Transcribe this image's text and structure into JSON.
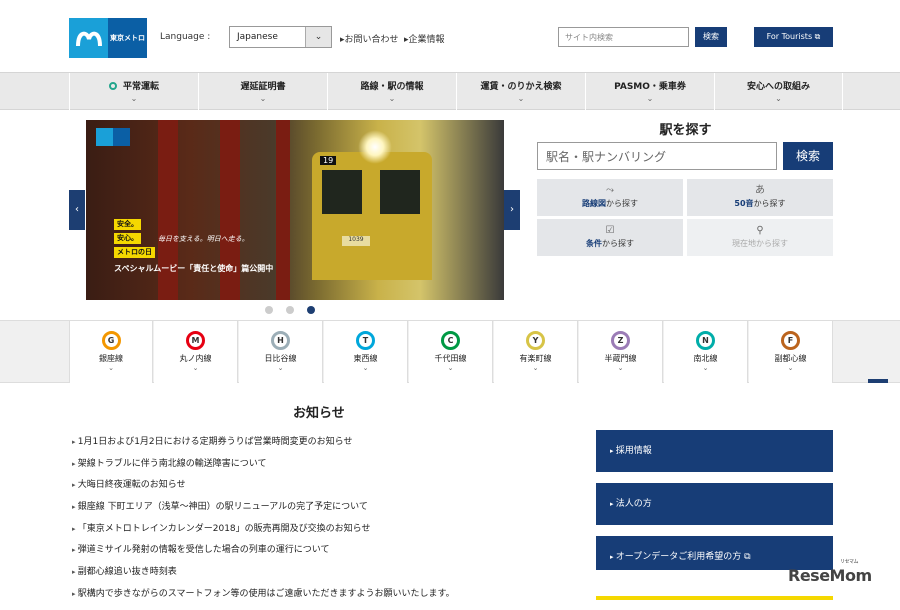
{
  "header": {
    "logo_text": "東京メトロ",
    "language_label": "Language :",
    "language_value": "Japanese",
    "contact": "お問い合わせ",
    "corporate": "企業情報",
    "search_placeholder": "サイト内検索",
    "search_button": "検索",
    "tourists_button": "For Tourists"
  },
  "nav": [
    {
      "label": "平常運転"
    },
    {
      "label": "遅延証明書"
    },
    {
      "label": "路線・駅の情報"
    },
    {
      "label": "運賃・のりかえ検索"
    },
    {
      "label": "PASMO・乗車券"
    },
    {
      "label": "安心への取組み"
    }
  ],
  "nav_chevron": "⌄",
  "hero": {
    "train_number": "19",
    "train_plate": "1039",
    "tags": [
      "安全。",
      "安心。",
      "メトロの日"
    ],
    "tagline": "毎日を支える。明日へ走る。",
    "caption": "スペシャルムービー「責任と使命」篇公開中",
    "prev": "‹",
    "next": "›"
  },
  "station_search": {
    "title": "駅を探す",
    "input_placeholder": "駅名・駅ナンバリング",
    "button": "検索",
    "options": [
      {
        "strong": "路線図",
        "rest": "から探す",
        "icon": "route-icon"
      },
      {
        "strong": "50音",
        "rest": "から探す",
        "icon": "kana-icon"
      },
      {
        "strong": "条件",
        "rest": "から探す",
        "icon": "checkbox-icon"
      },
      {
        "strong": "現在地",
        "rest": "から探す",
        "icon": "location-pin-icon"
      }
    ]
  },
  "lines": [
    {
      "code": "G",
      "name": "銀座線",
      "color": "#f39700"
    },
    {
      "code": "M",
      "name": "丸ノ内線",
      "color": "#e60012"
    },
    {
      "code": "H",
      "name": "日比谷線",
      "color": "#9caeb7"
    },
    {
      "code": "T",
      "name": "東西線",
      "color": "#00a7db"
    },
    {
      "code": "C",
      "name": "千代田線",
      "color": "#009944"
    },
    {
      "code": "Y",
      "name": "有楽町線",
      "color": "#d7c447"
    },
    {
      "code": "Z",
      "name": "半蔵門線",
      "color": "#9b7cb6"
    },
    {
      "code": "N",
      "name": "南北線",
      "color": "#00ada9"
    },
    {
      "code": "F",
      "name": "副都心線",
      "color": "#bb641d"
    }
  ],
  "line_chevron": "⌄",
  "news": {
    "title": "お知らせ",
    "items": [
      "1月1日および1月2日における定期券うりば営業時間変更のお知らせ",
      "架線トラブルに伴う南北線の輸送障害について",
      "大晦日終夜運転のお知らせ",
      "銀座線 下町エリア（浅草〜神田）の駅リニューアルの完了予定について",
      "「東京メトロトレインカレンダー2018」の販売再開及び交換のお知らせ",
      "弾道ミサイル発射の情報を受信した場合の列車の運行について",
      "副都心線追い抜き時刻表",
      "駅構内で歩きながらのスマートフォン等の使用はご遠慮いただきますようお願いいたします。"
    ]
  },
  "side_links": [
    "採用情報",
    "法人の方",
    "オープンデータご利用希望の方"
  ],
  "watermark": "ReseMom",
  "watermark_small": "リセマム",
  "colors": {
    "navy": "#173d77",
    "logo_blue": "#1aa0d8",
    "normal_service": "#22a58c"
  }
}
